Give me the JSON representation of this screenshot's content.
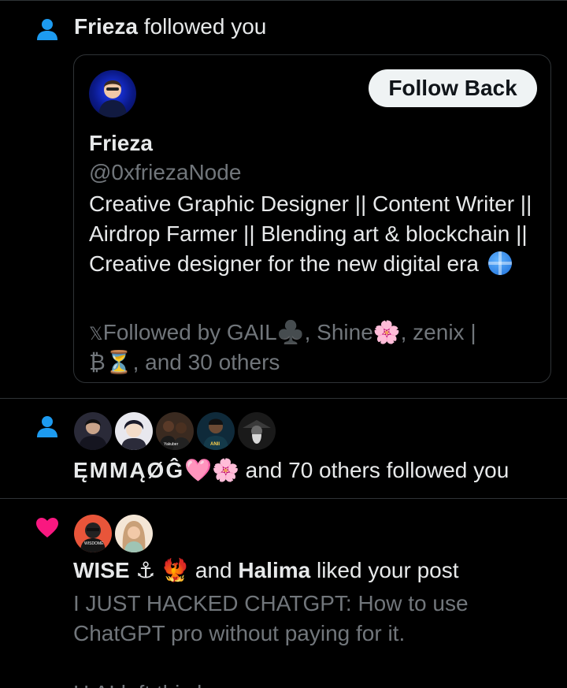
{
  "notifications": {
    "follow1": {
      "user": "Frieza",
      "action": "followed you",
      "card": {
        "follow_button": "Follow Back",
        "name": "Frieza",
        "handle": "@0xfriezaNode",
        "bio": "Creative Graphic Designer || Content Writer ||  Airdrop Farmer || Blending art & blockchain || Creative designer for the new digital era",
        "followed_by": "Followed by GAIL♣️, Shine🌸, zenix | ₿⏳, and 30 others"
      }
    },
    "follow2": {
      "names": "ĘMMĄØĜ",
      "emoji": "🩷🌸",
      "action": "and 70 others followed you",
      "avatar_labels": [
        "Yakuber",
        "ANII"
      ]
    },
    "like": {
      "user1": "WISE ⚓ 🐦‍🔥",
      "middle": "and",
      "user2": "Halima",
      "action": "liked your post",
      "post_line1": "I JUST HACKED CHATGPT: How to use ChatGPT pro without paying for it.",
      "post_line2": "H                          AI left this l",
      "avatar_label": "WISDOME"
    }
  },
  "colors": {
    "background": "#000000",
    "divider": "#2f3336",
    "text_primary": "#e7e9ea",
    "text_secondary": "#71767b",
    "person_icon": "#1d9bf0",
    "heart_icon": "#f91880",
    "button_bg": "#eff3f4"
  }
}
